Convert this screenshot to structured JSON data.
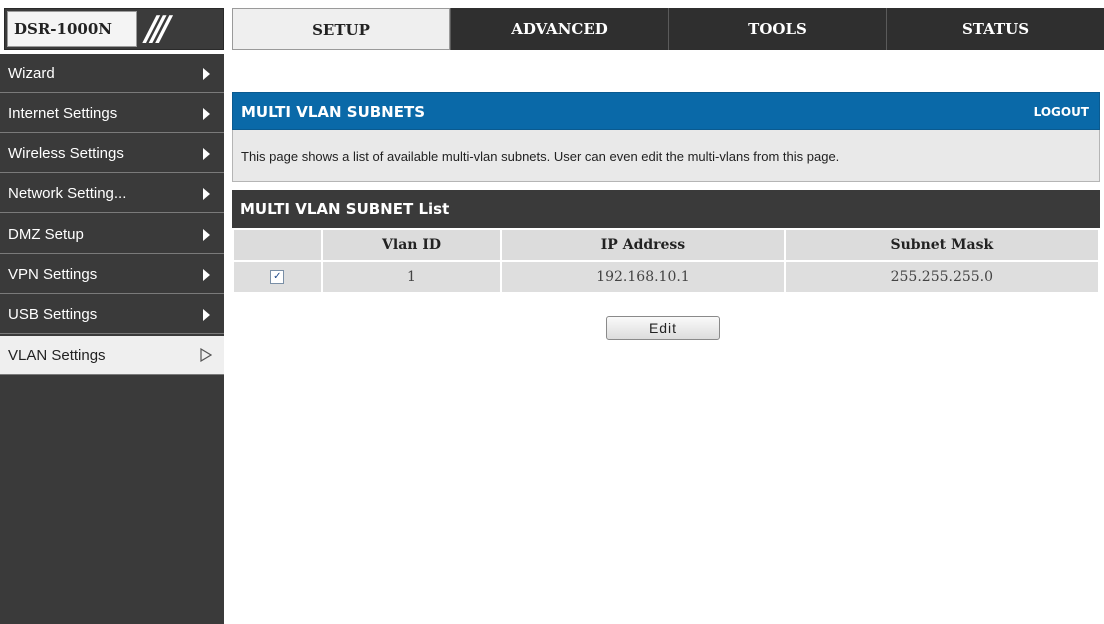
{
  "header": {
    "model": "DSR-1000N",
    "slashes": "///",
    "tabs": [
      {
        "label": "SETUP",
        "active": true
      },
      {
        "label": "ADVANCED",
        "active": false
      },
      {
        "label": "TOOLS",
        "active": false
      },
      {
        "label": "STATUS",
        "active": false
      }
    ]
  },
  "sidebar": {
    "items": [
      {
        "label": "Wizard"
      },
      {
        "label": "Internet Settings"
      },
      {
        "label": "Wireless Settings"
      },
      {
        "label": "Network Setting..."
      },
      {
        "label": "DMZ Setup"
      },
      {
        "label": "VPN Settings"
      },
      {
        "label": "USB Settings"
      },
      {
        "label": "VLAN Settings",
        "active": true
      }
    ]
  },
  "main": {
    "section_title": "MULTI VLAN SUBNETS",
    "logout_label": "LOGOUT",
    "description": "This page shows a list of available multi-vlan subnets. User can even edit the multi-vlans from this page.",
    "list_title": "MULTI VLAN SUBNET List",
    "table": {
      "columns": [
        "",
        "Vlan ID",
        "IP Address",
        "Subnet Mask"
      ],
      "rows": [
        {
          "checked": true,
          "vlan_id": "1",
          "ip_address": "192.168.10.1",
          "subnet_mask": "255.255.255.0"
        }
      ]
    },
    "edit_label": "Edit"
  },
  "colors": {
    "accent_blue": "#0a69a8",
    "dark": "#3a3a3a",
    "panel_grey": "#e9e9e9"
  }
}
